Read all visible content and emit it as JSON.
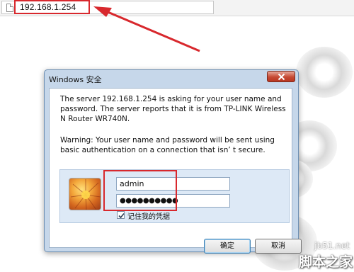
{
  "browser": {
    "address": "192.168.1.254"
  },
  "dialog": {
    "title": "Windows 安全",
    "message": "The server 192.168.1.254 is asking for your user name and password. The server reports that it is from TP-LINK Wireless N Router WR740N.",
    "warning": "Warning: Your user name and password will be sent using basic authentication on a connection that isn’ t secure.",
    "username_value": "admin",
    "password_mask": "●●●●●●●●●●",
    "remember_label": "记住我的凭据",
    "remember_checked": true,
    "ok_label": "确定",
    "cancel_label": "取消"
  },
  "watermark": {
    "site": "jb51.net",
    "brand": "脚本之家"
  },
  "colors": {
    "annotation": "#d8282d",
    "frame": "#c6d7ea"
  },
  "icons": {
    "page": "page-icon",
    "close": "close-icon",
    "avatar": "user-avatar-icon",
    "check": "checkmark-icon"
  }
}
